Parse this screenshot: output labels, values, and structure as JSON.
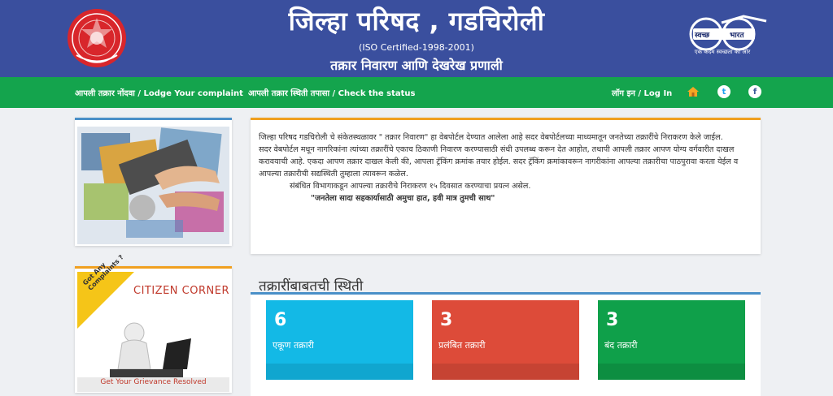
{
  "header": {
    "title": "जिल्हा परिषद , गडचिरोली",
    "subtitle": "(ISO Certified-1998-2001)",
    "tagline": "तक्रार निवारण आणि देखरेख प्रणाली",
    "swachh_left": "स्वच्छ",
    "swachh_right": "भारत",
    "swachh_caption": "एक कदम स्वच्छता की ओर"
  },
  "nav": {
    "lodge": "आपली तक्रार नोंदवा / Lodge Your complaint",
    "check": "आपली तक्रार स्थिती तपासा / Check the status",
    "login": "लॉग इन / Log In",
    "home_icon": "home-icon",
    "twitter_icon": "twitter-icon",
    "facebook_icon": "facebook-icon"
  },
  "intro": {
    "p1": "जिल्हा परिषद गडचिरोली चे संकेतस्थळावर \" तक्रार निवारण\" हा वेबपोर्टल देण्यात आलेला आहे सदर वेबपोर्टलच्या माध्यमातून जनतेच्या तक्रारींचे निराकरण केले जाईल.",
    "p2": "सदर वेबपोर्टल मधून नागरिकांना त्यांच्या तक्रारींचे एकाच ठिकाणी निवारण करण्यासाठी संधी उपलब्ध करून देत आहोत, तथापी आपली तक्रार आपण योग्य वर्गवारीत दाखल करावयाची आहे. एकदा आपण तक्रार दाखल केली की, आपला ट्रॅकिंग क्रमांक तयार होईल. सदर ट्रॅकिंग क्रमांकावरून नागरीकांना आपल्या तक्रारीचा पाठपुरावा करता येईल व आपल्या तक्रारीची सद्यस्थिती तुम्हाला त्यावरून कळेल.",
    "p3": "संबंधित विभागाकडून आपल्या तक्रारीचे निराकरण १५ दिवसात करण्याचा प्रयत्न असेल.",
    "slogan": "\"जनतेला सादा सहकार्यासाठी अमुचा हात, हवी मात्र तुमची साथ\""
  },
  "citizen": {
    "badge": "Got Any Complaints ?",
    "title": "CITIZEN CORNER",
    "footer": "Get Your Grievance Resolved"
  },
  "status": {
    "title": "तक्रारींबाबतची स्थिती",
    "cards": [
      {
        "count": "6",
        "label": "एकूण तक्रारी",
        "color": "#13b9e6",
        "foot": "#10a6cf"
      },
      {
        "count": "3",
        "label": "प्रलंबित तक्रारी",
        "color": "#dd4b39",
        "foot": "#c64333"
      },
      {
        "count": "3",
        "label": "बंद तक्रारी",
        "color": "#0fa04a",
        "foot": "#0d8e41"
      }
    ]
  }
}
